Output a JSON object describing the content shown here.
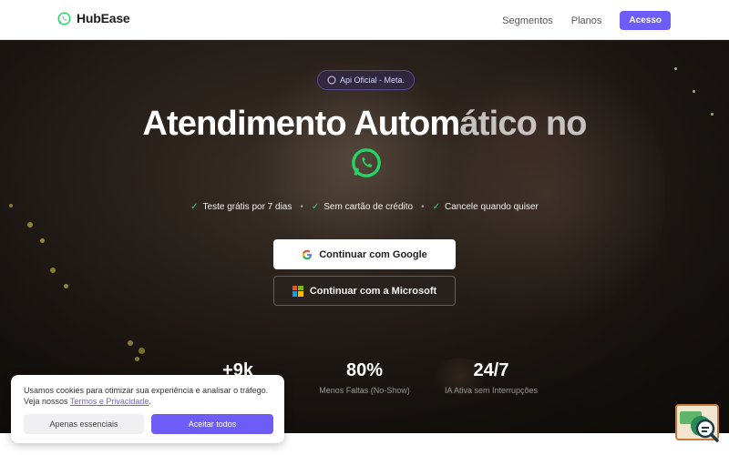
{
  "header": {
    "brand": "HubEase",
    "nav": [
      {
        "label": "Segmentos"
      },
      {
        "label": "Planos"
      }
    ],
    "cta": "Acesso"
  },
  "hero": {
    "badge": "Api Oficial - Meta.",
    "headline_main": "Atendimento Autom",
    "headline_fade": "ático no",
    "features": [
      "Teste grátis por 7 dias",
      "Sem cartão de crédito",
      "Cancele quando quiser"
    ],
    "google_button": "Continuar com Google",
    "microsoft_button": "Continuar com a Microsoft",
    "stats": [
      {
        "value": "+9k",
        "label": ""
      },
      {
        "value": "80%",
        "label": "Menos Faltas (No-Show)"
      },
      {
        "value": "24/7",
        "label": "IA Ativa sem Interrupções"
      }
    ]
  },
  "cookie": {
    "text_line1": "Usamos cookies para otimizar sua experiência e analisar o tráfego.",
    "text_prefix": "Veja nossos ",
    "link": "Termos e Privacidade",
    "text_suffix": ".",
    "essential_button": "Apenas essenciais",
    "accept_button": "Aceitar todos"
  },
  "icons": {
    "brand": "whatsapp-icon",
    "badge": "whatsapp-icon",
    "hero": "whatsapp-icon",
    "check": "check-icon",
    "google": "google-icon",
    "microsoft": "microsoft-icon",
    "widget": "search-magnifier-icon"
  },
  "colors": {
    "accent": "#6d5cf6",
    "whatsapp_green": "#25d366",
    "check_green": "#3bd16f"
  }
}
